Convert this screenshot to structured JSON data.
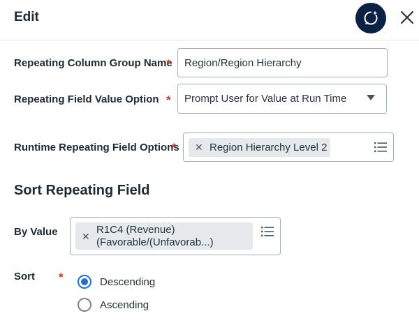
{
  "header": {
    "title": "Edit"
  },
  "form": {
    "group_name": {
      "label": "Repeating Column Group Name",
      "required_mark": "*",
      "value": "Region/Region Hierarchy"
    },
    "value_option": {
      "label": "Repeating Field Value Option",
      "required_mark": "*",
      "value": "Prompt User for Value at Run Time"
    },
    "runtime_options": {
      "label": "Runtime Repeating Field Options",
      "required_mark": "*",
      "selected": [
        "Region Hierarchy Level 2"
      ]
    }
  },
  "sort_section": {
    "title": "Sort Repeating Field",
    "by_value": {
      "label": "By Value",
      "selected_line1": "R1C4 (Revenue)",
      "selected_line2": "(Favorable/(Unfavorab...)"
    },
    "sort": {
      "label": "Sort",
      "required_mark": "*",
      "options": [
        "Descending",
        "Ascending"
      ],
      "selected": "Descending"
    }
  },
  "icons": {
    "assist": "sparkle-chat-icon",
    "close": "close-icon",
    "remove": "x-icon",
    "list": "list-icon",
    "dropdown": "chevron-down-icon"
  },
  "colors": {
    "assist_bg": "#0b2145",
    "required": "#d0362b",
    "radio_selected": "#1f6fd6",
    "pill_bg": "#e6e9ec"
  }
}
